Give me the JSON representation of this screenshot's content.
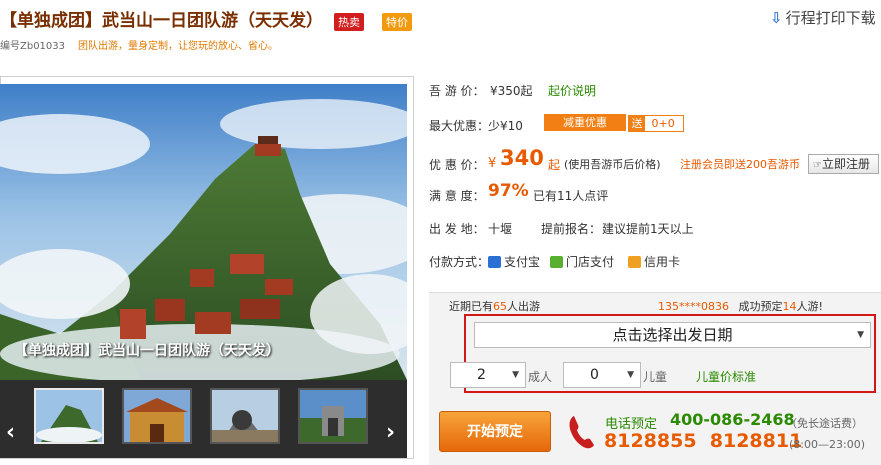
{
  "header": {
    "title": "【单独成团】武当山一日团队游（天天发）",
    "badge_hot": "热卖",
    "badge_special": "特价",
    "print_link": "行程打印下载",
    "code": "编号Zb01033",
    "slogan": "团队出游，量身定制，让您玩的放心、省心。"
  },
  "gallery": {
    "caption": "【单独成团】武当山一日团队游（天天发）",
    "prev": "‹",
    "next": "›"
  },
  "info": {
    "price_label": "吾 游 价：",
    "price_value": "¥350起",
    "price_note": "起价说明",
    "discount_label": "最大优惠：",
    "discount_value": "少¥10",
    "discount_tag": "减重优惠",
    "send_label": "送",
    "send_value": "0+0",
    "youhui_label": "优 惠 价：",
    "currency": "¥",
    "youhui_value": "340",
    "youhui_suffix": "起",
    "youhui_note": "(使用吾游币后价格)",
    "register_promo": "注册会员即送200吾游币",
    "register_button": "立即注册",
    "satisfaction_label": "满 意 度：",
    "satisfaction_value": "97%",
    "review_count": "已有11人点评",
    "depart_label": "出 发 地：",
    "depart_value": "十堰",
    "advance_label": "提前报名：",
    "advance_value": "建议提前1天以上",
    "pay_label": "付款方式：",
    "pay_alipay": "支付宝",
    "pay_store": "门店支付",
    "pay_card": "信用卡"
  },
  "booking": {
    "recent_prefix": "近期已有",
    "recent_count": "65",
    "recent_suffix": "人出游",
    "recent_phone": "135****0836",
    "recent_booked_prefix": "成功预定",
    "recent_booked_count": "14",
    "recent_booked_suffix": "人游!",
    "date_placeholder": "点击选择出发日期",
    "adult_count": "2",
    "adult_label": "成人",
    "child_count": "0",
    "child_label": "儿童",
    "child_price_link": "儿童价标准",
    "book_button": "开始预定",
    "phone_label": "电话预定",
    "phone_main": "400-086-2468",
    "phone_free": "（免长途话费）",
    "phone_alt": "8128855  8128811",
    "phone_hours": "(8:00—23:00)"
  },
  "icons": {
    "print": "download-icon",
    "phone": "telephone-icon"
  },
  "colors": {
    "accent_orange": "#e85a00",
    "accent_green": "#2a8a00",
    "highlight_red": "#d01818"
  }
}
